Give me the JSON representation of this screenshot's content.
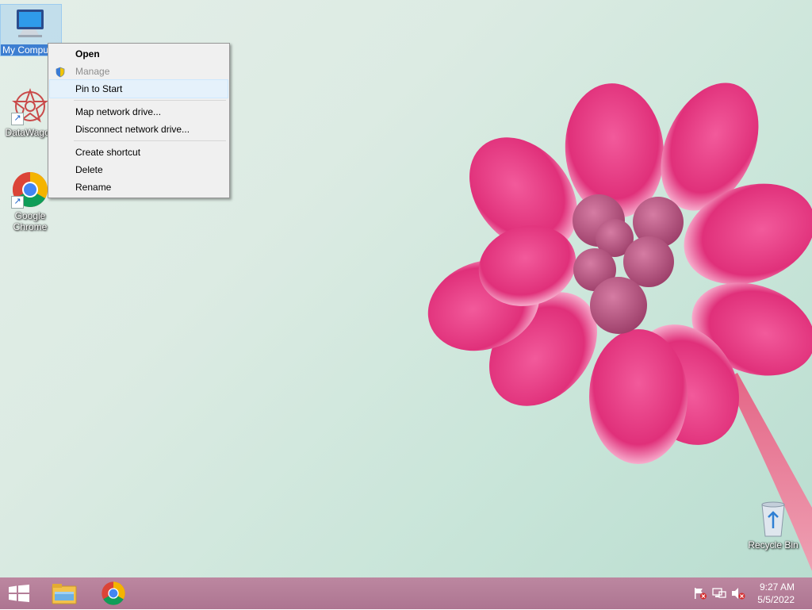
{
  "desktop": {
    "icons": [
      {
        "label": "My Computer",
        "icon": "computer-icon"
      },
      {
        "label": "DataWagon",
        "icon": "datawagon-icon"
      },
      {
        "label": "Google Chrome",
        "icon": "chrome-icon"
      },
      {
        "label": "Recycle Bin",
        "icon": "recycle-bin-icon"
      }
    ]
  },
  "context_menu": {
    "items": [
      {
        "label": "Open"
      },
      {
        "label": "Manage",
        "icon": "shield-icon"
      },
      {
        "label": "Pin to Start"
      },
      {
        "label": "Map network drive..."
      },
      {
        "label": "Disconnect network drive..."
      },
      {
        "label": "Create shortcut"
      },
      {
        "label": "Delete"
      },
      {
        "label": "Rename"
      }
    ]
  },
  "taskbar": {
    "start_icon": "windows-logo-icon",
    "pinned": [
      {
        "icon": "file-explorer-icon"
      },
      {
        "icon": "chrome-icon"
      }
    ],
    "tray": {
      "icons": [
        "action-center-flag-icon",
        "network-icon",
        "volume-muted-icon"
      ],
      "time": "9:27 AM",
      "date": "5/5/2022"
    }
  },
  "colors": {
    "taskbar": "#b27593",
    "selection": "#3d7ed1",
    "flower": "#e0307a"
  }
}
